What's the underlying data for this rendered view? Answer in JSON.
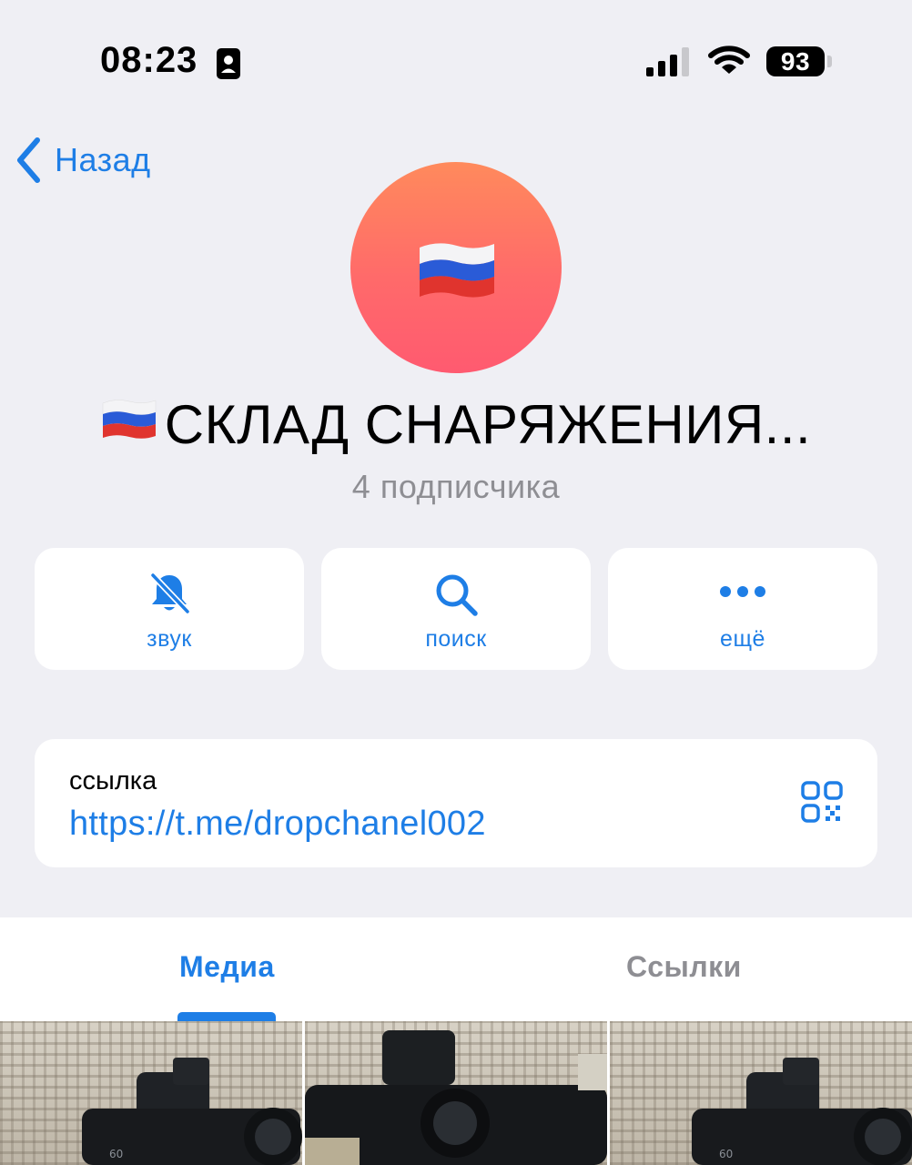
{
  "status_bar": {
    "time": "08:23",
    "battery": "93"
  },
  "nav": {
    "back_label": "Назад"
  },
  "channel": {
    "title": "СКЛАД СНАРЯЖЕНИЯ...",
    "subscribers": "4 подписчика",
    "avatar_emoji": "russian-flag-emoji"
  },
  "actions": [
    {
      "label": "звук",
      "icon": "bell-slash-icon"
    },
    {
      "label": "поиск",
      "icon": "search-icon"
    },
    {
      "label": "ещё",
      "icon": "more-dots-icon"
    }
  ],
  "link_card": {
    "caption": "ссылка",
    "url": "https://t.me/dropchanel002"
  },
  "tabs": [
    {
      "label": "Медиа",
      "active": true
    },
    {
      "label": "Ссылки",
      "active": false
    }
  ],
  "colors": {
    "accent": "#1e7ee6",
    "background": "#efeff4",
    "secondary_text": "#8e8e93",
    "avatar_gradient_top": "#ff8a5c",
    "avatar_gradient_bottom": "#ff5a70"
  }
}
